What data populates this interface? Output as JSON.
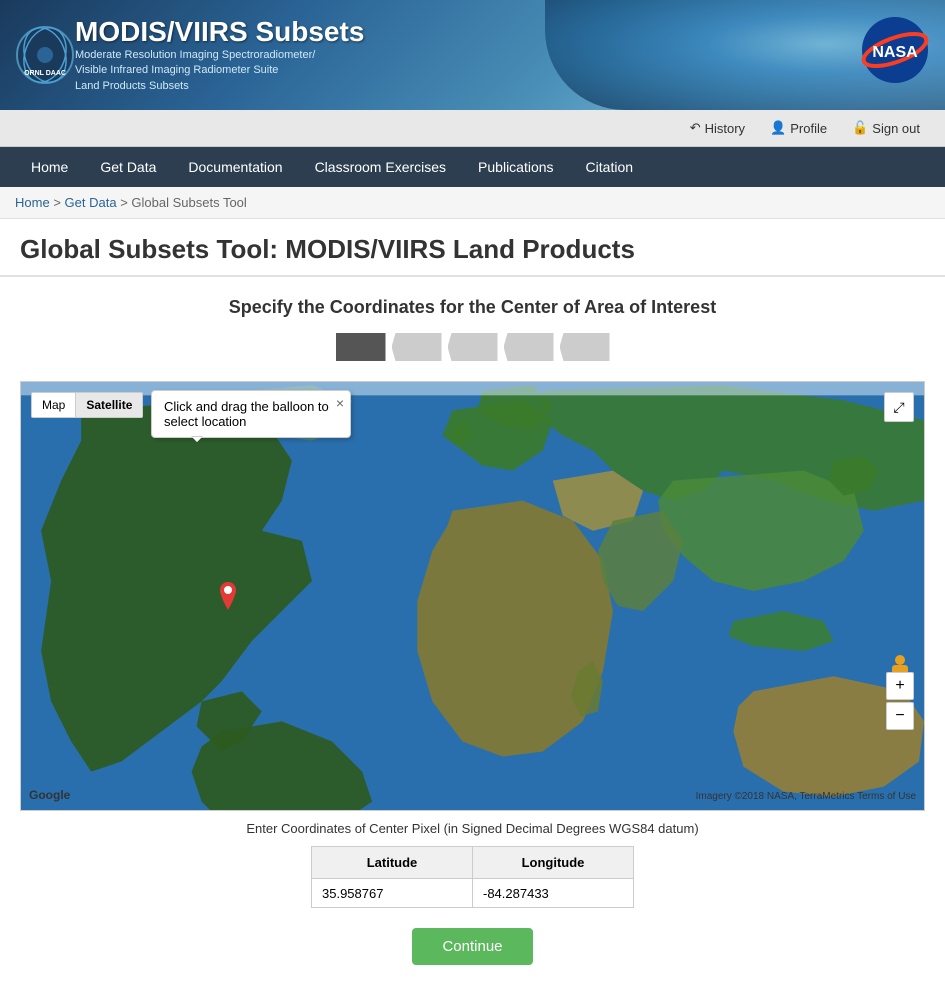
{
  "header": {
    "site_title": "MODIS/VIIRS Subsets",
    "subtitle_line1": "Moderate Resolution Imaging Spectroradiometer/",
    "subtitle_line2": "Visible Infrared Imaging Radiometer Suite",
    "subtitle_line3": "Land Products Subsets",
    "org": "ORNL DAAC"
  },
  "top_nav": {
    "history_label": "History",
    "profile_label": "Profile",
    "signout_label": "Sign out"
  },
  "main_nav": {
    "items": [
      {
        "label": "Home",
        "id": "home"
      },
      {
        "label": "Get Data",
        "id": "get-data"
      },
      {
        "label": "Documentation",
        "id": "documentation"
      },
      {
        "label": "Classroom Exercises",
        "id": "classroom"
      },
      {
        "label": "Publications",
        "id": "publications"
      },
      {
        "label": "Citation",
        "id": "citation"
      }
    ]
  },
  "breadcrumb": {
    "home": "Home",
    "get_data": "Get Data",
    "current": "Global Subsets Tool"
  },
  "page": {
    "title": "Global Subsets Tool: MODIS/VIIRS Land Products",
    "section_title": "Specify the Coordinates for the Center of Area of Interest"
  },
  "map": {
    "toggle_map": "Map",
    "toggle_satellite": "Satellite",
    "tooltip_text": "Click and drag the balloon to select location",
    "tooltip_close": "×",
    "fullscreen_icon": "⤢",
    "zoom_in": "+",
    "zoom_out": "−",
    "google_label": "Google",
    "attribution": "Imagery ©2018 NASA, TerraMetrics   Terms of Use"
  },
  "coordinates": {
    "description": "Enter Coordinates of Center Pixel (in Signed Decimal Degrees WGS84 datum)",
    "latitude_label": "Latitude",
    "longitude_label": "Longitude",
    "latitude_value": "35.958767",
    "longitude_value": "-84.287433"
  },
  "buttons": {
    "continue_label": "Continue"
  }
}
